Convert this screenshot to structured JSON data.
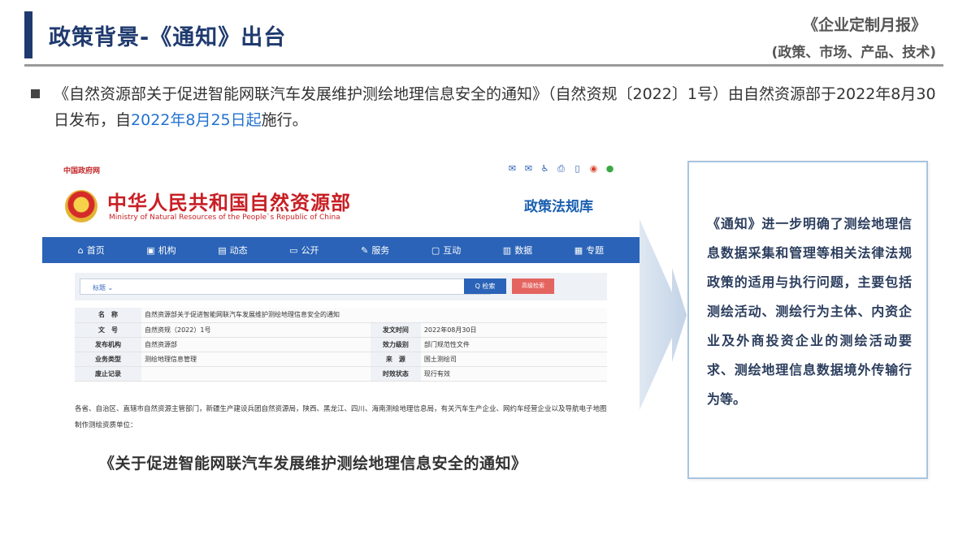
{
  "header": {
    "title": "政策背景-《通知》出台",
    "report_name": "《企业定制月报》",
    "report_tags": "(政策、市场、产品、技术)"
  },
  "intro": {
    "part1": "《自然资源部关于促进智能网联汽车发展维护测绘地理信息安全的通知》（自然资规〔2022〕1号）由自然资源部于2022年8月30日发布，自",
    "highlight": "2022年8月25日起",
    "part2": "施行。",
    "highlight_color": "#2473d1"
  },
  "website": {
    "gov_link": "中国政府网",
    "top_icons": [
      "mail-icon",
      "mail-alt-icon",
      "accessibility-icon",
      "print-icon",
      "mobile-icon",
      "weibo-icon",
      "wechat-icon"
    ],
    "ministry_cn": "中华人民共和国自然资源部",
    "ministry_en": "Ministry of Natural Resources of the People`s Republic of China",
    "section": "政策法规库",
    "nav": [
      {
        "icon": "home-icon",
        "glyph": "⌂",
        "label": "首页"
      },
      {
        "icon": "org-icon",
        "glyph": "▣",
        "label": "机构"
      },
      {
        "icon": "book-icon",
        "glyph": "▤",
        "label": "动态"
      },
      {
        "icon": "monitor-icon",
        "glyph": "▭",
        "label": "公开"
      },
      {
        "icon": "edit-icon",
        "glyph": "✎",
        "label": "服务"
      },
      {
        "icon": "chat-icon",
        "glyph": "▢",
        "label": "互动"
      },
      {
        "icon": "chart-icon",
        "glyph": "▥",
        "label": "数据"
      },
      {
        "icon": "save-icon",
        "glyph": "▦",
        "label": "专题"
      }
    ],
    "search": {
      "field": "标题 ⌄",
      "button": "Q 检索",
      "advanced": "高级检索"
    },
    "table": {
      "name_label": "名　称",
      "name_value": "自然资源部关于促进智能网联汽车发展维护测绘地理信息安全的通知",
      "doc_no_label": "文　号",
      "doc_no_value": "自然资规（2022）1号",
      "issue_time_label": "发文时间",
      "issue_time_value": "2022年08月30日",
      "issuer_label": "发布机构",
      "issuer_value": "自然资源部",
      "level_label": "效力级别",
      "level_value": "部门规范性文件",
      "type_label": "业务类型",
      "type_value": "测绘地理信息管理",
      "source_label": "来　源",
      "source_value": "国土测绘司",
      "abolish_label": "废止记录",
      "abolish_value": "",
      "status_label": "时效状态",
      "status_value": "现行有效"
    },
    "recipients": "各省、自治区、直辖市自然资源主管部门，新疆生产建设兵团自然资源局，陕西、黑龙江、四川、海南测绘地理信息局，有关汽车生产企业、网约车经营企业以及导航电子地图制作测绘资质单位："
  },
  "caption": "《关于促进智能网联汽车发展维护测绘地理信息安全的通知》",
  "callout": "《通知》进一步明确了测绘地理信息数据采集和管理等相关法律法规政策的适用与执行问题，主要包括测绘活动、测绘行为主体、内资企业及外商投资企业的测绘活动要求、测绘地理信息数据境外传输行为等。"
}
